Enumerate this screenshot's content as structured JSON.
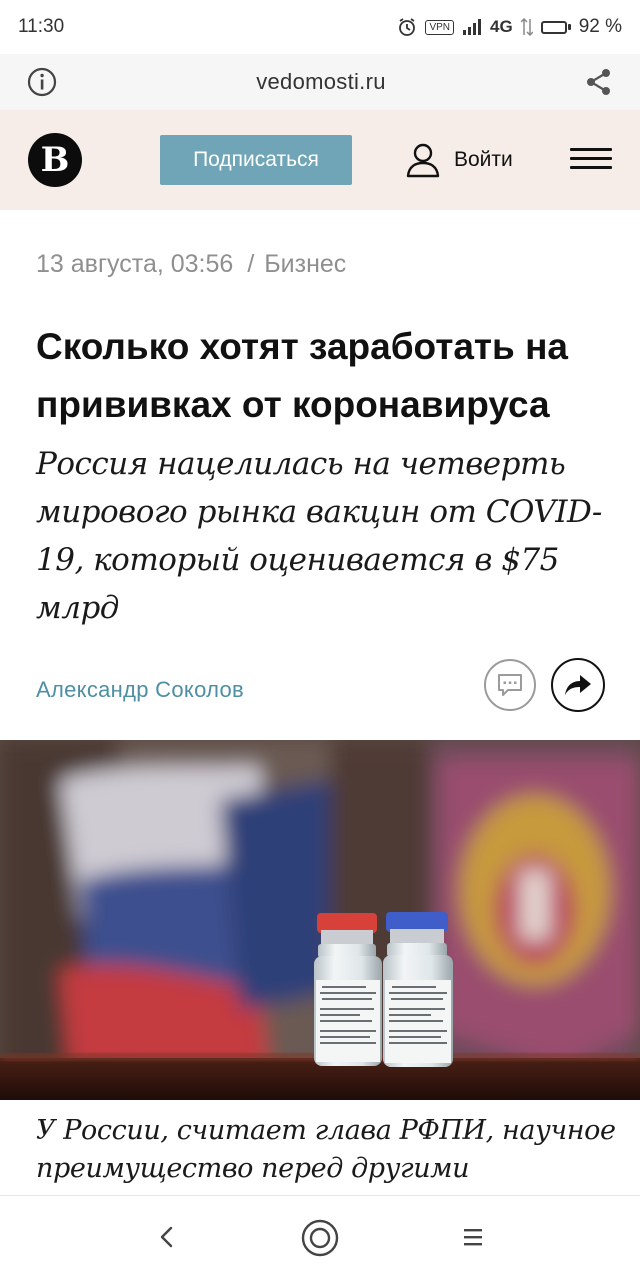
{
  "status_bar": {
    "time": "11:30",
    "alarm_icon": "alarm-icon",
    "vpn": "VPN",
    "network": "4G",
    "battery": "92 %",
    "battery_level": 0.92
  },
  "browser": {
    "url": "vedomosti.ru",
    "info_icon": "info-icon",
    "share_icon": "share-icon"
  },
  "site_header": {
    "logo_letter": "В",
    "subscribe_label": "Подписаться",
    "login_label": "Войти",
    "subscribe_color": "#6fa5b6"
  },
  "article": {
    "date": "13 августа, 03:56",
    "separator": "/",
    "rubric": "Бизнес",
    "headline": "Сколько хотят заработать на прививках от коронавируса",
    "lead": "Россия нацелилась на четверть мирового рынка вакцин от COVID-19, который оценивается в $75 млрд",
    "author": "Александр Соколов",
    "author_color": "#4e8fa2",
    "photo_label_1": "Гам-КОВИД-Вак",
    "photo_label_2": "Гам-КОВИД-Вак",
    "caption": "У России, считает глава РФПИ, научное преимущество перед другими"
  },
  "nav_bar": {
    "back_icon": "back-icon",
    "home_icon": "home-icon",
    "menu_icon": "menu-icon"
  }
}
